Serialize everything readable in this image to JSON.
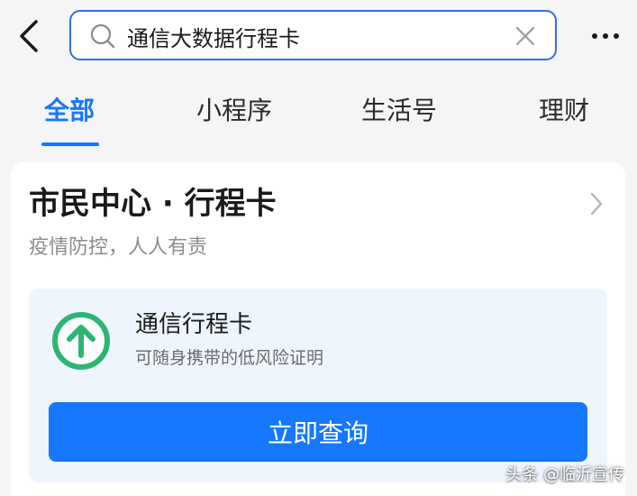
{
  "header": {
    "back_icon": "chevron-left-icon",
    "search": {
      "value": "通信大数据行程卡",
      "placeholder": "",
      "search_icon": "magnifier-icon",
      "clear_icon": "close-icon"
    },
    "more_icon": "more-dots-icon"
  },
  "tabs": [
    {
      "label": "全部",
      "active": true
    },
    {
      "label": "小程序",
      "active": false
    },
    {
      "label": "生活号",
      "active": false
    },
    {
      "label": "理财",
      "active": false
    }
  ],
  "result_card": {
    "title": "市民中心 · 行程卡",
    "subtitle": "疫情防控，人人有责",
    "service": {
      "icon": "green-up-arrow-icon",
      "name": "通信行程卡",
      "description": "可随身携带的低风险证明",
      "button_label": "立即查询"
    }
  },
  "watermark": "头条 @临沂宣传",
  "colors": {
    "accent": "#1677ff",
    "search_border": "#2f6fe0",
    "service_icon_green": "#2bb673",
    "panel_bg": "#eef5fd",
    "subtitle_gray": "#8c8c8c"
  }
}
